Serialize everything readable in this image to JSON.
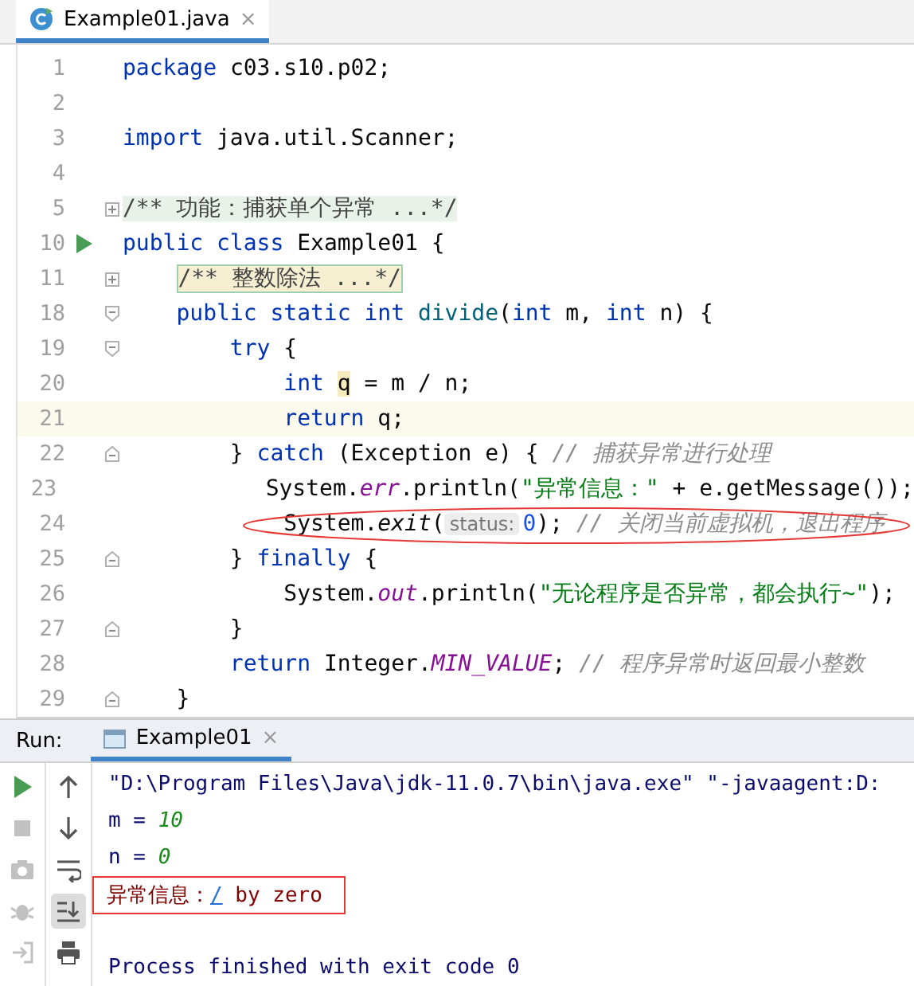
{
  "editor_tabs": [
    {
      "label": "Example01.java",
      "close": "×",
      "selected": true
    }
  ],
  "code_lines": [
    {
      "number": "1",
      "kind": "plain",
      "current": false,
      "annotated": false,
      "tokens": [
        {
          "kind": "kw",
          "t": "package"
        },
        {
          "kind": "plain",
          "t": " c03.s10.p02;"
        }
      ]
    },
    {
      "number": "2",
      "kind": "plain",
      "current": false,
      "annotated": false
    },
    {
      "number": "3",
      "kind": "plain",
      "current": false,
      "annotated": false,
      "tokens": [
        {
          "kind": "kw",
          "t": "import"
        },
        {
          "kind": "plain",
          "t": " java.util.Scanner;"
        }
      ]
    },
    {
      "number": "4",
      "kind": "plain",
      "current": false,
      "annotated": false
    },
    {
      "number": "5",
      "kind": "collapsed",
      "current": false,
      "annotated": false,
      "tokens": [
        {
          "kind": "folded-doc",
          "t": "/** 功能：捕获单个异常 ...*/"
        }
      ]
    },
    {
      "number": "10",
      "kind": "runnable",
      "current": false,
      "annotated": false,
      "tokens": [
        {
          "kind": "kw",
          "t": "public class"
        },
        {
          "kind": "plain",
          "t": " Example01 {"
        }
      ]
    },
    {
      "number": "11",
      "kind": "collapsed",
      "current": false,
      "annotated": false,
      "tokens": [
        {
          "kind": "folded-block",
          "t": "/** 整数除法 ...*/",
          "indent": true
        }
      ]
    },
    {
      "number": "18",
      "kind": "start",
      "current": false,
      "annotated": false,
      "tokens": [
        {
          "kind": "kw",
          "t": "    public static int "
        },
        {
          "kind": "method",
          "t": "divide"
        },
        {
          "kind": "plain",
          "t": "("
        },
        {
          "kind": "kw",
          "t": "int"
        },
        {
          "kind": "plain",
          "t": " m, "
        },
        {
          "kind": "kw",
          "t": "int"
        },
        {
          "kind": "plain",
          "t": " n) {"
        }
      ]
    },
    {
      "number": "19",
      "kind": "start",
      "current": false,
      "annotated": false,
      "tokens": [
        {
          "kind": "kw",
          "t": "        try"
        },
        {
          "kind": "plain",
          "t": " {"
        }
      ]
    },
    {
      "number": "20",
      "kind": "plain",
      "current": false,
      "annotated": false,
      "tokens": [
        {
          "kind": "kw",
          "t": "            int "
        },
        {
          "kind": "usage",
          "t": "q"
        },
        {
          "kind": "plain",
          "t": " = m / n;"
        }
      ]
    },
    {
      "number": "21",
      "kind": "plain",
      "current": true,
      "annotated": false,
      "tokens": [
        {
          "kind": "kw",
          "t": "            return"
        },
        {
          "kind": "plain",
          "t": " q;"
        }
      ]
    },
    {
      "number": "22",
      "kind": "end",
      "current": false,
      "annotated": false,
      "tokens": [
        {
          "kind": "plain",
          "t": "        } "
        },
        {
          "kind": "kw",
          "t": "catch"
        },
        {
          "kind": "plain",
          "t": " (Exception e) { "
        },
        {
          "kind": "comment",
          "t": "// 捕获异常进行处理"
        }
      ]
    },
    {
      "number": "23",
      "kind": "plain",
      "current": false,
      "annotated": false,
      "tokens": [
        {
          "kind": "plain",
          "t": "            System."
        },
        {
          "kind": "field",
          "t": "err"
        },
        {
          "kind": "plain",
          "t": ".println("
        },
        {
          "kind": "str",
          "t": "\"异常信息：\""
        },
        {
          "kind": "plain",
          "t": " + e.getMessage());"
        }
      ]
    },
    {
      "number": "24",
      "kind": "plain",
      "current": false,
      "annotated": true,
      "tokens": [
        {
          "kind": "plain",
          "t": "            System."
        },
        {
          "kind": "static",
          "t": "exit"
        },
        {
          "kind": "plain",
          "t": "("
        },
        {
          "kind": "hint",
          "t": "status:"
        },
        {
          "kind": "num",
          "t": "0"
        },
        {
          "kind": "plain",
          "t": "); "
        },
        {
          "kind": "comment",
          "t": "// 关闭当前虚拟机，退出程序"
        }
      ]
    },
    {
      "number": "25",
      "kind": "end",
      "current": false,
      "annotated": false,
      "tokens": [
        {
          "kind": "plain",
          "t": "        } "
        },
        {
          "kind": "kw",
          "t": "finally"
        },
        {
          "kind": "plain",
          "t": " {"
        }
      ]
    },
    {
      "number": "26",
      "kind": "plain",
      "current": false,
      "annotated": false,
      "tokens": [
        {
          "kind": "plain",
          "t": "            System."
        },
        {
          "kind": "field",
          "t": "out"
        },
        {
          "kind": "plain",
          "t": ".println("
        },
        {
          "kind": "str",
          "t": "\"无论程序是否异常，都会执行~\""
        },
        {
          "kind": "plain",
          "t": ");"
        }
      ]
    },
    {
      "number": "27",
      "kind": "end",
      "current": false,
      "annotated": false,
      "tokens": [
        {
          "kind": "plain",
          "t": "        }"
        }
      ]
    },
    {
      "number": "28",
      "kind": "plain",
      "current": false,
      "annotated": false,
      "tokens": [
        {
          "kind": "kw",
          "t": "        return"
        },
        {
          "kind": "plain",
          "t": " Integer."
        },
        {
          "kind": "field",
          "t": "MIN_VALUE"
        },
        {
          "kind": "plain",
          "t": "; "
        },
        {
          "kind": "comment",
          "t": "// 程序异常时返回最小整数"
        }
      ]
    },
    {
      "number": "29",
      "kind": "end",
      "current": false,
      "annotated": false,
      "tokens": [
        {
          "kind": "plain",
          "t": "    }"
        }
      ]
    }
  ],
  "run_panel": {
    "label": "Run:",
    "tabs": [
      {
        "label": "Example01",
        "close": "×",
        "selected": true
      }
    ],
    "toolbar_left": [
      {
        "kind": "run",
        "disabled": false
      },
      {
        "kind": "stop",
        "disabled": true
      },
      {
        "kind": "camera",
        "disabled": true
      },
      {
        "kind": "bug",
        "disabled": true
      },
      {
        "kind": "login",
        "disabled": true
      }
    ],
    "toolbar_right": [
      {
        "kind": "up",
        "selected": false
      },
      {
        "kind": "down",
        "selected": false
      },
      {
        "kind": "wrap",
        "selected": false
      },
      {
        "kind": "scroll-end",
        "selected": true
      },
      {
        "kind": "print",
        "selected": false
      }
    ],
    "console_lines": [
      {
        "boxed": false,
        "tokens": [
          {
            "kind": "out",
            "t": "\"D:\\Program Files\\Java\\jdk-11.0.7\\bin\\java.exe\" \"-javaagent:D:"
          }
        ]
      },
      {
        "boxed": false,
        "tokens": [
          {
            "kind": "out",
            "t": "m = "
          },
          {
            "kind": "value",
            "t": "10"
          }
        ]
      },
      {
        "boxed": false,
        "tokens": [
          {
            "kind": "out",
            "t": "n = "
          },
          {
            "kind": "value",
            "t": "0"
          }
        ]
      },
      {
        "boxed": true,
        "tokens": [
          {
            "kind": "err",
            "t": "异常信息："
          },
          {
            "kind": "link",
            "t": "/"
          },
          {
            "kind": "err",
            "t": " by zero"
          }
        ]
      },
      {
        "boxed": false
      },
      {
        "boxed": false,
        "tokens": [
          {
            "kind": "out",
            "t": "Process finished with exit code 0"
          }
        ]
      }
    ]
  }
}
